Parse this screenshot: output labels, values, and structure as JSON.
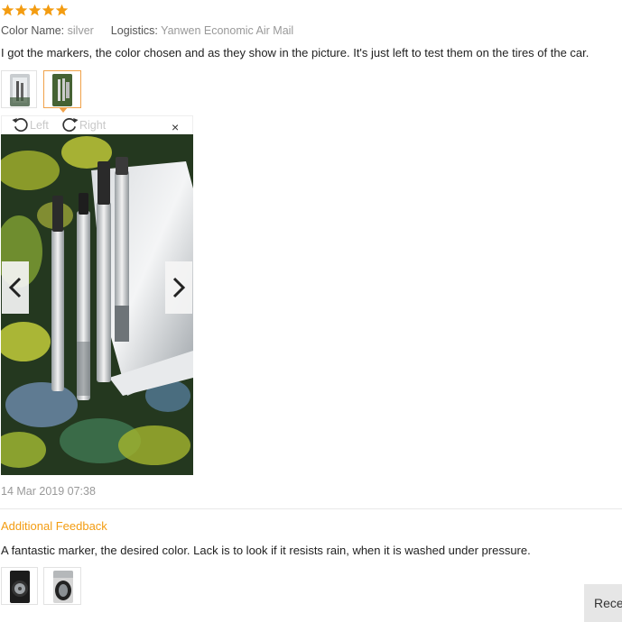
{
  "rating": {
    "stars": 5,
    "max": 5,
    "color": "#f39c11"
  },
  "meta": {
    "color_label": "Color Name:",
    "color_value": "silver",
    "logistics_label": "Logistics:",
    "logistics_value": "Yanwen Economic Air Mail"
  },
  "review": {
    "text": "I got the markers, the color chosen and as they show in the picture. It's just left to test them on the tires of the car.",
    "date": "14 Mar 2019 07:38"
  },
  "thumbnails": [
    {
      "icon": "photo-thumbnail-icon",
      "active": false
    },
    {
      "icon": "photo-thumbnail-icon",
      "active": true
    }
  ],
  "viewer": {
    "rotate_left_label": "Left",
    "rotate_right_label": "Right",
    "close_symbol": "×",
    "prev_icon": "chevron-left-icon",
    "next_icon": "chevron-right-icon"
  },
  "additional": {
    "title": "Additional Feedback",
    "text": "A fantastic marker, the desired color. Lack is to look if it resists rain, when it is washed under pressure.",
    "thumbnails": [
      {
        "icon": "tire-photo-icon"
      },
      {
        "icon": "tire-photo-icon"
      }
    ]
  },
  "recent_button": {
    "label": "Rece"
  },
  "colors": {
    "accent": "#f39c11",
    "active_border": "#f0a24a"
  }
}
